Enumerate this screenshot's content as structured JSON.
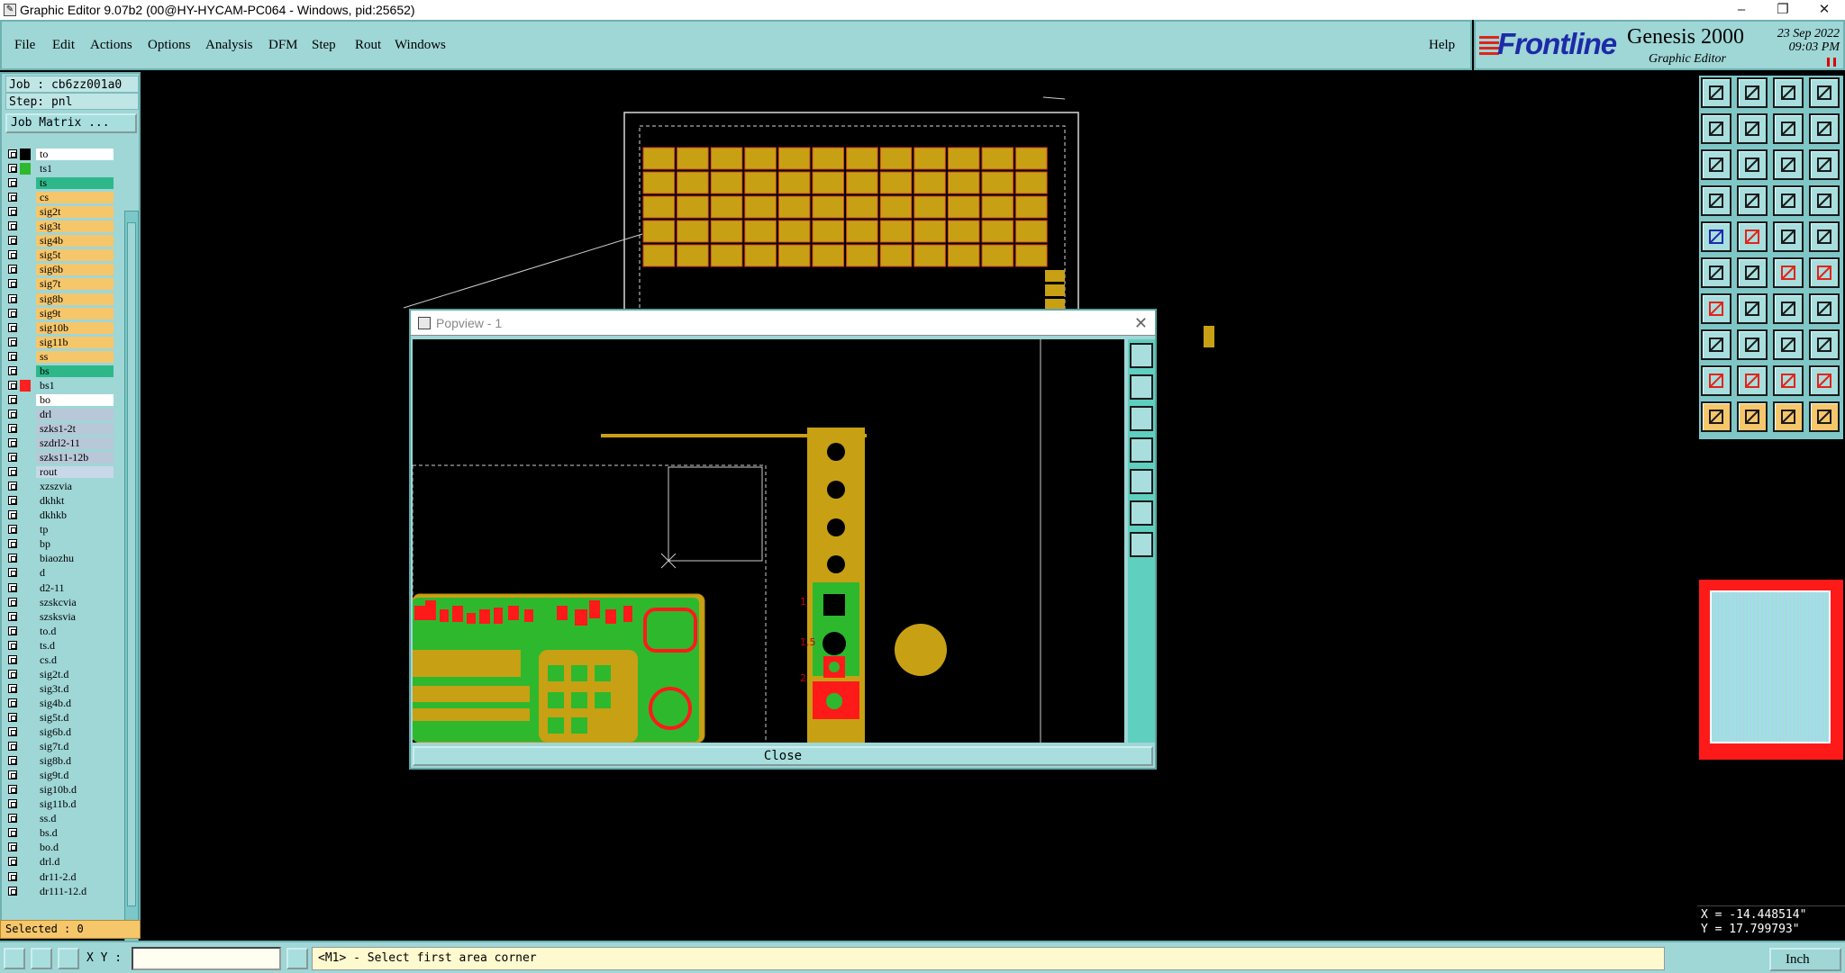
{
  "window": {
    "title": "Graphic Editor 9.07b2 (00@HY-HYCAM-PC064 - Windows, pid:25652)",
    "controls": [
      "–",
      "❐",
      "✕"
    ]
  },
  "menu": {
    "items": [
      "File",
      "Edit",
      "Actions",
      "Options",
      "Analysis",
      "DFM",
      "Step",
      "Rout",
      "Windows"
    ],
    "help": "Help"
  },
  "brand": {
    "logo": "Frontline",
    "product": "Genesis 2000",
    "subtitle": "Graphic Editor",
    "date": "23 Sep 2022",
    "time": "09:03 PM"
  },
  "job": {
    "job_label": "Job : cb6zz001a0",
    "step_label": "Step: pnl",
    "matrix_button": "Job Matrix ..."
  },
  "layers": [
    {
      "name": "to",
      "color": "#ffffff",
      "swatch": "#000000"
    },
    {
      "name": "ts1",
      "color": "#9fd6d6",
      "swatch": "#2eb82e"
    },
    {
      "name": "ts",
      "color": "#2eb88a",
      "swatch": "#9fd6d6"
    },
    {
      "name": "cs",
      "color": "#f6c66b",
      "swatch": "#9fd6d6"
    },
    {
      "name": "sig2t",
      "color": "#f6c66b",
      "swatch": "#9fd6d6"
    },
    {
      "name": "sig3t",
      "color": "#f6c66b",
      "swatch": "#9fd6d6"
    },
    {
      "name": "sig4b",
      "color": "#f6c66b",
      "swatch": "#9fd6d6"
    },
    {
      "name": "sig5t",
      "color": "#f6c66b",
      "swatch": "#9fd6d6"
    },
    {
      "name": "sig6b",
      "color": "#f6c66b",
      "swatch": "#9fd6d6"
    },
    {
      "name": "sig7t",
      "color": "#f6c66b",
      "swatch": "#9fd6d6"
    },
    {
      "name": "sig8b",
      "color": "#f6c66b",
      "swatch": "#9fd6d6"
    },
    {
      "name": "sig9t",
      "color": "#f6c66b",
      "swatch": "#9fd6d6"
    },
    {
      "name": "sig10b",
      "color": "#f6c66b",
      "swatch": "#9fd6d6"
    },
    {
      "name": "sig11b",
      "color": "#f6c66b",
      "swatch": "#9fd6d6"
    },
    {
      "name": "ss",
      "color": "#f6c66b",
      "swatch": "#9fd6d6"
    },
    {
      "name": "bs",
      "color": "#2eb88a",
      "swatch": "#9fd6d6"
    },
    {
      "name": "bs1",
      "color": "#9fd6d6",
      "swatch": "#ff2020"
    },
    {
      "name": "bo",
      "color": "#ffffff",
      "swatch": "#9fd6d6"
    },
    {
      "name": "drl",
      "color": "#b8c8d8",
      "swatch": "#9fd6d6"
    },
    {
      "name": "szks1-2t",
      "color": "#b8c8d8",
      "swatch": "#9fd6d6"
    },
    {
      "name": "szdrl2-11",
      "color": "#b8c8d8",
      "swatch": "#9fd6d6"
    },
    {
      "name": "szks11-12b",
      "color": "#b8c8d8",
      "swatch": "#9fd6d6"
    },
    {
      "name": "rout",
      "color": "#c8d8e8",
      "swatch": "#9fd6d6"
    },
    {
      "name": "xzszvia",
      "color": "#9fd6d6",
      "swatch": "#9fd6d6"
    },
    {
      "name": "dkhkt",
      "color": "#9fd6d6",
      "swatch": "#9fd6d6"
    },
    {
      "name": "dkhkb",
      "color": "#9fd6d6",
      "swatch": "#9fd6d6"
    },
    {
      "name": "tp",
      "color": "#9fd6d6",
      "swatch": "#9fd6d6"
    },
    {
      "name": "bp",
      "color": "#9fd6d6",
      "swatch": "#9fd6d6"
    },
    {
      "name": "biaozhu",
      "color": "#9fd6d6",
      "swatch": "#9fd6d6"
    },
    {
      "name": "d",
      "color": "#9fd6d6",
      "swatch": "#9fd6d6"
    },
    {
      "name": "d2-11",
      "color": "#9fd6d6",
      "swatch": "#9fd6d6"
    },
    {
      "name": "szskcvia",
      "color": "#9fd6d6",
      "swatch": "#9fd6d6"
    },
    {
      "name": "szsksvia",
      "color": "#9fd6d6",
      "swatch": "#9fd6d6"
    },
    {
      "name": "to.d",
      "color": "#9fd6d6",
      "swatch": "#9fd6d6"
    },
    {
      "name": "ts.d",
      "color": "#9fd6d6",
      "swatch": "#9fd6d6"
    },
    {
      "name": "cs.d",
      "color": "#9fd6d6",
      "swatch": "#9fd6d6"
    },
    {
      "name": "sig2t.d",
      "color": "#9fd6d6",
      "swatch": "#9fd6d6"
    },
    {
      "name": "sig3t.d",
      "color": "#9fd6d6",
      "swatch": "#9fd6d6"
    },
    {
      "name": "sig4b.d",
      "color": "#9fd6d6",
      "swatch": "#9fd6d6"
    },
    {
      "name": "sig5t.d",
      "color": "#9fd6d6",
      "swatch": "#9fd6d6"
    },
    {
      "name": "sig6b.d",
      "color": "#9fd6d6",
      "swatch": "#9fd6d6"
    },
    {
      "name": "sig7t.d",
      "color": "#9fd6d6",
      "swatch": "#9fd6d6"
    },
    {
      "name": "sig8b.d",
      "color": "#9fd6d6",
      "swatch": "#9fd6d6"
    },
    {
      "name": "sig9t.d",
      "color": "#9fd6d6",
      "swatch": "#9fd6d6"
    },
    {
      "name": "sig10b.d",
      "color": "#9fd6d6",
      "swatch": "#9fd6d6"
    },
    {
      "name": "sig11b.d",
      "color": "#9fd6d6",
      "swatch": "#9fd6d6"
    },
    {
      "name": "ss.d",
      "color": "#9fd6d6",
      "swatch": "#9fd6d6"
    },
    {
      "name": "bs.d",
      "color": "#9fd6d6",
      "swatch": "#9fd6d6"
    },
    {
      "name": "bo.d",
      "color": "#9fd6d6",
      "swatch": "#9fd6d6"
    },
    {
      "name": "drl.d",
      "color": "#9fd6d6",
      "swatch": "#9fd6d6"
    },
    {
      "name": "dr11-2.d",
      "color": "#9fd6d6",
      "swatch": "#9fd6d6"
    },
    {
      "name": "dr111-12.d",
      "color": "#9fd6d6",
      "swatch": "#9fd6d6"
    }
  ],
  "selected": "Selected : 0",
  "popview": {
    "title": "Popview - 1",
    "close_button": "Close",
    "close_icon": "✕",
    "pad_labels": [
      "1",
      "1.5",
      "2"
    ]
  },
  "coords": {
    "x": "X = -14.448514\"",
    "y": "Y = 17.799793\""
  },
  "status": {
    "xy_label": "X Y :",
    "xy_value": "",
    "prompt": "<M1> - Select first area corner",
    "unit": "Inch"
  },
  "colors": {
    "panel": "#9fd6d6",
    "copper": "#c8a014",
    "mask": "#2eb82e",
    "red": "#ff1a1a"
  }
}
